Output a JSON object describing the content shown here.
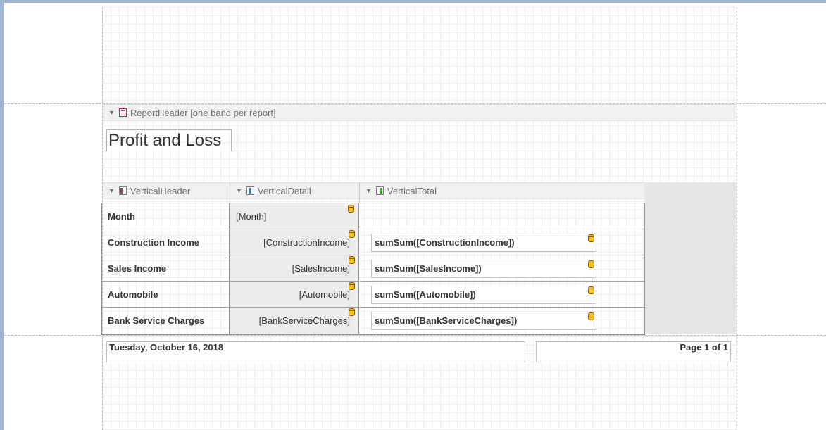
{
  "report_header": {
    "band_label": "ReportHeader [one band per report]",
    "title": "Profit and Loss"
  },
  "vertical_bands": {
    "header_label": "VerticalHeader",
    "detail_label": "VerticalDetail",
    "total_label": "VerticalTotal"
  },
  "rows": [
    {
      "label": "Month",
      "detail": "[Month]",
      "total": ""
    },
    {
      "label": "Construction Income",
      "detail": "[ConstructionIncome]",
      "total": "sumSum([ConstructionIncome])"
    },
    {
      "label": "Sales Income",
      "detail": "[SalesIncome]",
      "total": "sumSum([SalesIncome])"
    },
    {
      "label": "Automobile",
      "detail": "[Automobile]",
      "total": "sumSum([Automobile])"
    },
    {
      "label": "Bank Service Charges",
      "detail": "[BankServiceCharges]",
      "total": "sumSum([BankServiceCharges])"
    }
  ],
  "footer": {
    "date": "Tuesday, October 16, 2018",
    "page_info": "Page 1 of 1"
  },
  "icons": {
    "collapse_arrow": "triangle-down",
    "report_header_icon": "report-header-band-icon",
    "field_binding_icon": "database-icon"
  },
  "colors": {
    "frame": "#9fb5d4",
    "band_header_bg": "#f0f0f0",
    "detail_bg": "#ececec",
    "database_icon": "#f7c21c"
  }
}
